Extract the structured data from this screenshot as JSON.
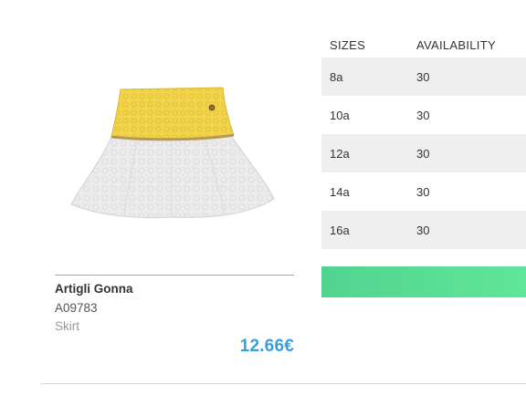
{
  "product": {
    "name": "Artigli Gonna",
    "code": "A09783",
    "category": "Skirt",
    "price": "12.66€",
    "image_icon": "skirt-illustration",
    "colors": {
      "waistband": "#f2d44c",
      "skirt": "#ececec",
      "piping": "#b59a55",
      "price": "#3b9ed8"
    }
  },
  "size_table": {
    "headers": {
      "size": "SIZES",
      "availability": "AVAILABILITY"
    },
    "rows": [
      {
        "size": "8a",
        "availability": "30"
      },
      {
        "size": "10a",
        "availability": "30"
      },
      {
        "size": "12a",
        "availability": "30"
      },
      {
        "size": "14a",
        "availability": "30"
      },
      {
        "size": "16a",
        "availability": "30"
      }
    ]
  },
  "cta": {
    "label": "",
    "color": "#55dc94"
  }
}
